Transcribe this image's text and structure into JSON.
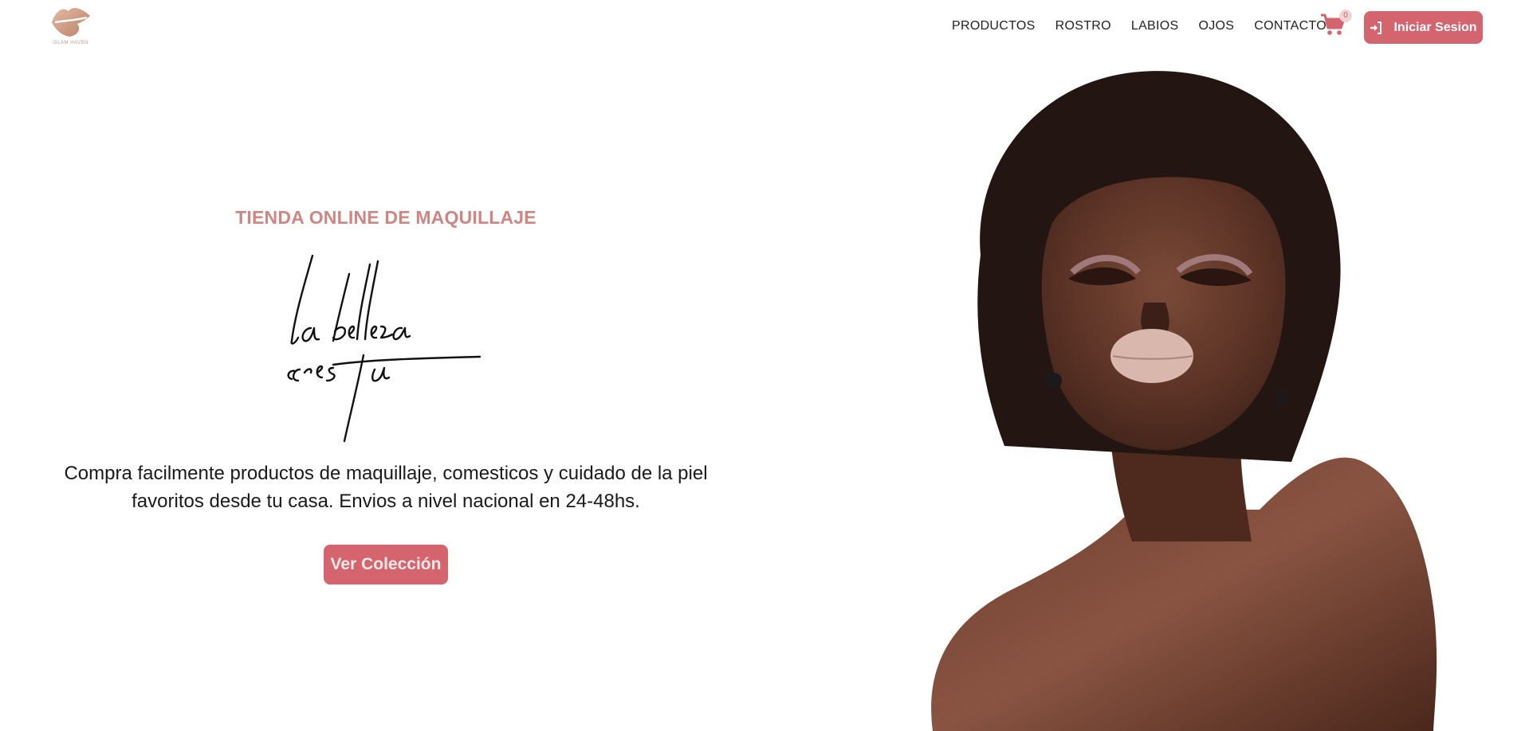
{
  "header": {
    "logo_text": "GLAM HAVEN",
    "nav": [
      {
        "label": "PRODUCTOS"
      },
      {
        "label": "ROSTRO"
      },
      {
        "label": "LABIOS"
      },
      {
        "label": "OJOS"
      },
      {
        "label": "CONTACTO"
      }
    ],
    "cart_count": "0",
    "cart_icon": "cart-icon",
    "login_icon": "sign-in-icon",
    "login_label": "Iniciar Sesion"
  },
  "hero": {
    "eyebrow": "TIENDA ONLINE DE MAQUILLAJE",
    "script_line1": "la belleza",
    "script_line2": "eres tu",
    "description": "Compra facilmente productos de maquillaje, comesticos y cuidado de la piel favoritos desde tu casa. Envios a nivel nacional en 24-48hs.",
    "cta_label": "Ver Colección"
  },
  "colors": {
    "accent": "#d4646d",
    "eyebrow": "#d18582",
    "logo": "#c79a82"
  }
}
